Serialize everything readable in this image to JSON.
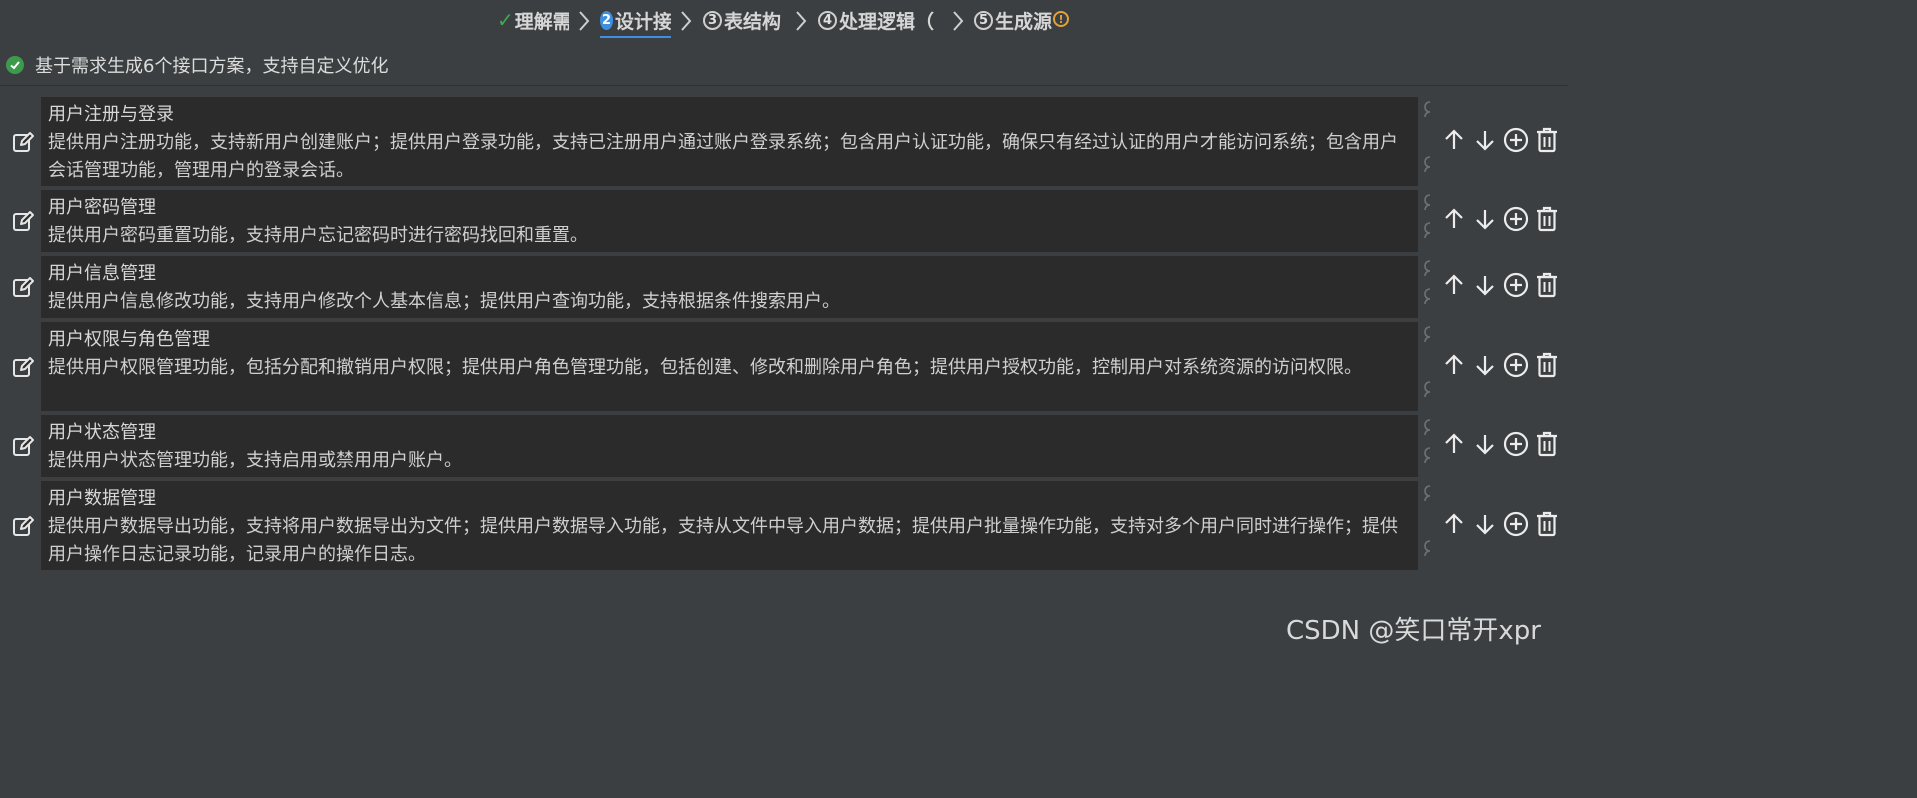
{
  "stepper": {
    "steps": [
      {
        "num": "",
        "label": "理解需",
        "state": "done"
      },
      {
        "num": "2",
        "label": "设计接",
        "state": "active"
      },
      {
        "num": "3",
        "label": "表结构",
        "state": "todo"
      },
      {
        "num": "4",
        "label": "处理逻辑（",
        "state": "todo"
      },
      {
        "num": "5",
        "label": "生成源",
        "state": "todo"
      }
    ],
    "warning_icon": "warning-icon"
  },
  "status": {
    "icon": "check-circle-icon",
    "text": "基于需求生成6个接口方案，支持自定义优化"
  },
  "items": [
    {
      "title": "用户注册与登录",
      "desc": "提供用户注册功能，支持新用户创建账户；提供用户登录功能，支持已注册用户通过账户登录系统；包含用户认证功能，确保只有经过认证的用户才能访问系统；包含用户会话管理功能，管理用户的登录会话。"
    },
    {
      "title": "用户密码管理",
      "desc": "提供用户密码重置功能，支持用户忘记密码时进行密码找回和重置。"
    },
    {
      "title": "用户信息管理",
      "desc": "提供用户信息修改功能，支持用户修改个人基本信息；提供用户查询功能，支持根据条件搜索用户。"
    },
    {
      "title": "用户权限与角色管理",
      "desc": "提供用户权限管理功能，包括分配和撤销用户权限；提供用户角色管理功能，包括创建、修改和删除用户角色；提供用户授权功能，控制用户对系统资源的访问权限。"
    },
    {
      "title": "用户状态管理",
      "desc": "提供用户状态管理功能，支持启用或禁用用户账户。"
    },
    {
      "title": "用户数据管理",
      "desc": "提供用户数据导出功能，支持将用户数据导出为文件；提供用户数据导入功能，支持从文件中导入用户数据；提供用户批量操作功能，支持对多个用户同时进行操作；提供用户操作日志记录功能，记录用户的操作日志。"
    }
  ],
  "icons": {
    "edit": "edit-icon",
    "up": "arrow-up-icon",
    "down": "arrow-down-icon",
    "add": "plus-circle-icon",
    "delete": "trash-icon",
    "drag": "drag-hook-icon"
  },
  "watermark": "CSDN @笑口常开xpr",
  "colors": {
    "accent": "#3d8fe0",
    "success": "#3c9a4d",
    "warning": "#e3a13a",
    "background": "#3c3f41",
    "card": "#2b2b2b"
  }
}
